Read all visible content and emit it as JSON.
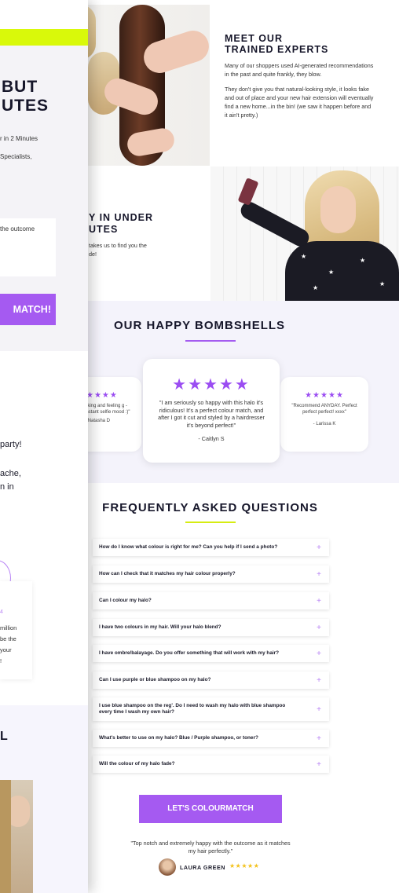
{
  "experts": {
    "title_line1": "MEET OUR",
    "title_line2": "TRAINED EXPERTS",
    "para1": "Many of our shoppers used AI-generated recommendations in the past and quite frankly, they blow.",
    "para2": "They don't give you that natural-looking style, it looks fake and out of place and your new hair extension will eventually find a new home...in the bin! (we saw it happen before and it ain't pretty.)"
  },
  "under": {
    "title_line1": "Y IN UNDER",
    "title_line2": "UTES",
    "text_line1": "takes us to find you the",
    "text_line2": "de!"
  },
  "bombshells": {
    "title": "OUR HAPPY BOMBSHELLS",
    "reviews": [
      {
        "stars": "★★★★",
        "text": "oking and feeling g - instant selfie mood :)\"",
        "author": "- Natasha D"
      },
      {
        "stars": "★★★★★",
        "text": "\"I am seriously so happy with this halo it's ridiculous! It's a perfect colour match, and after I got it cut and styled by a hairdresser it's beyond perfect!\"",
        "author": "- Caitlyn S"
      },
      {
        "stars": "★★★★★",
        "text": "\"Recommend ANYDAY. Perfect perfect perfect! xxxx\"",
        "author": "- Larissa K"
      }
    ]
  },
  "faq": {
    "title": "FREQUENTLY ASKED QUESTIONS",
    "items": [
      "How do I know what colour is right for me? Can you help if I send a photo?",
      "How can I check that it matches my hair colour properly?",
      "Can I colour my halo?",
      "I have two colours in my hair. Will your halo blend?",
      "I have ombre/balayage. Do you offer something that will work with my hair?",
      "Can I use purple or blue shampoo on my halo?",
      "I use blue shampoo on the reg'. Do I need to wash my halo with blue shampoo every time I wash my own hair?",
      "What's better to use on my halo? Blue / Purple shampoo, or toner?",
      "Will the colour of my halo fade?"
    ],
    "plus": "+"
  },
  "cta": {
    "label": "LET'S COLOURMATCH",
    "quote": "\"Top notch and extremely happy with the outcome as it matches my hair perfectly.\"",
    "reviewer": "LAURA GREEN",
    "stars": "★★★★★"
  },
  "overlay": {
    "big_line1": "BUT",
    "big_line2": "UTES",
    "small1": "r in 2 Minutes",
    "small2": " Specialists,",
    "box_text": "the outcome",
    "button": "MATCH!",
    "party": "party!",
    "ache": "ache,",
    "in": "n in",
    "card_star": "4",
    "card_l1": "million",
    "card_l2": "be the",
    "card_l3": "your",
    "card_l4": "!",
    "letter": "L"
  },
  "colors": {
    "purple": "#a55af1",
    "yellow": "#d9f90a",
    "lavender": "#f4f3fb"
  }
}
